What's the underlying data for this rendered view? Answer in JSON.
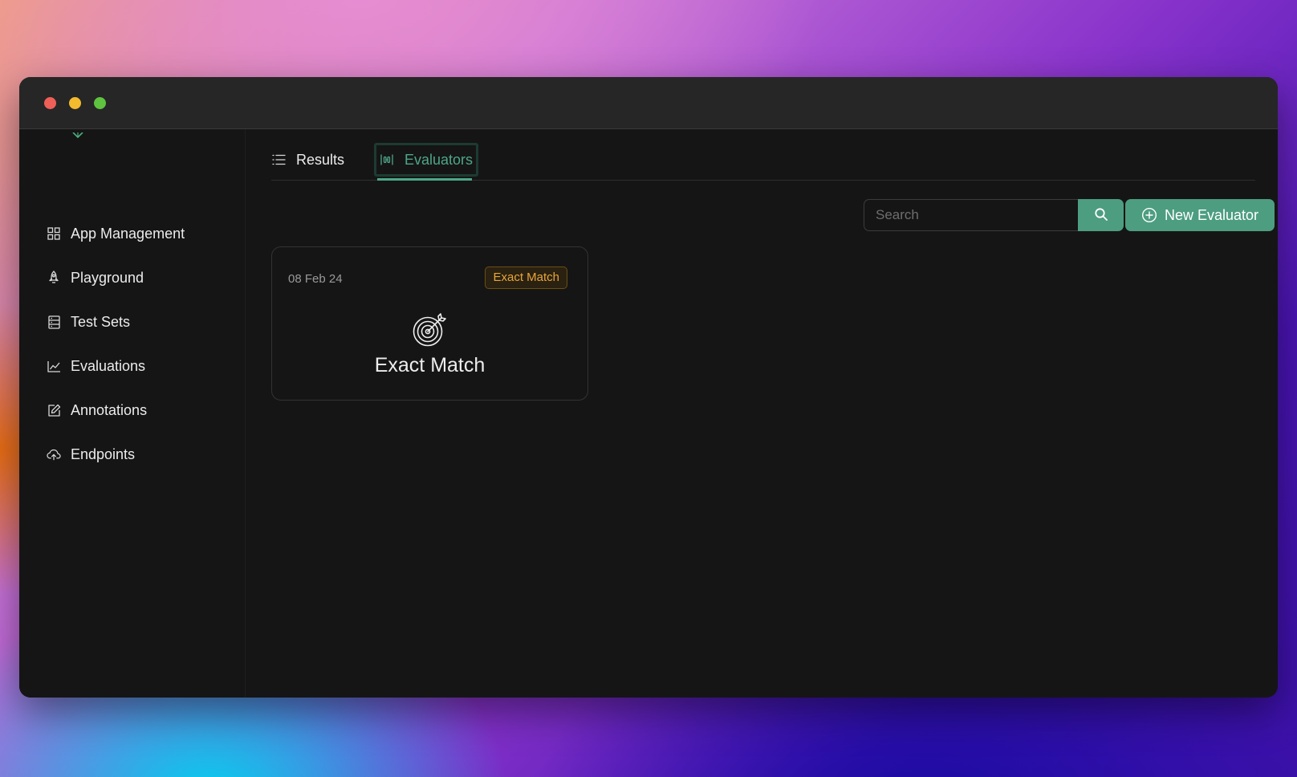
{
  "window": {
    "title_bar": {
      "buttons": [
        "close",
        "minimize",
        "zoom"
      ]
    }
  },
  "sidebar": {
    "items": [
      {
        "label": "App Management",
        "icon": "grid-icon"
      },
      {
        "label": "Playground",
        "icon": "rocket-icon"
      },
      {
        "label": "Test Sets",
        "icon": "database-icon"
      },
      {
        "label": "Evaluations",
        "icon": "line-chart-icon"
      },
      {
        "label": "Annotations",
        "icon": "edit-icon"
      },
      {
        "label": "Endpoints",
        "icon": "cloud-upload-icon"
      }
    ]
  },
  "tabs": [
    {
      "label": "Results",
      "icon": "list-icon",
      "active": false
    },
    {
      "label": "Evaluators",
      "icon": "sliders-icon",
      "active": true
    }
  ],
  "toolbar": {
    "search_placeholder": "Search",
    "search_value": "",
    "new_button_label": "New Evaluator"
  },
  "evaluators": [
    {
      "date": "08 Feb 24",
      "badge": "Exact Match",
      "title": "Exact Match",
      "icon": "target-icon"
    }
  ],
  "colors": {
    "accent": "#4d9d81",
    "badge_text": "#e8a63b",
    "window_bg": "#151515",
    "titlebar_bg": "#262626"
  }
}
